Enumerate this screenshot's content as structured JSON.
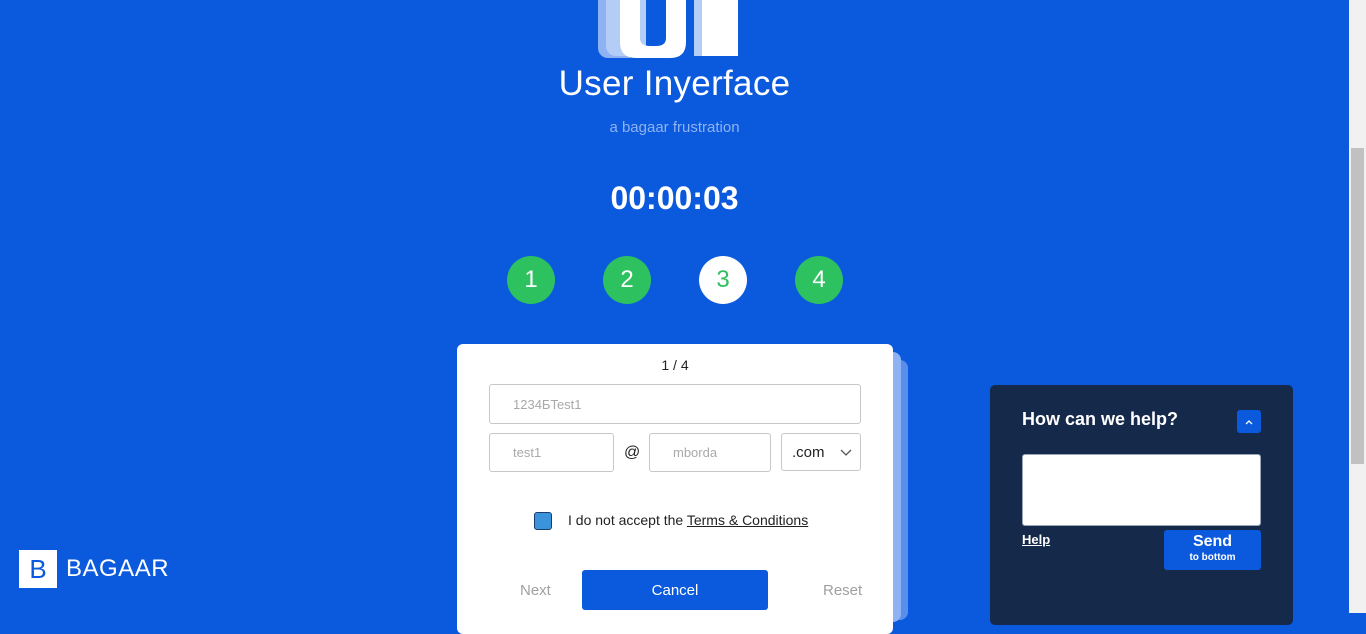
{
  "header": {
    "logo_text": "UI",
    "title": "User Inyerface",
    "subtitle": "a bagaar frustration"
  },
  "timer": "00:00:03",
  "steps": [
    {
      "label": "1",
      "state": "done"
    },
    {
      "label": "2",
      "state": "done"
    },
    {
      "label": "3",
      "state": "current"
    },
    {
      "label": "4",
      "state": "done"
    }
  ],
  "form": {
    "page_indicator": "1 / 4",
    "password_placeholder": "1234БTest1",
    "email_placeholder": "test1",
    "at_sign": "@",
    "domain_placeholder": "mborda",
    "tld_value": ".com",
    "terms_prefix": "I do not accept the ",
    "terms_link": "Terms & Conditions",
    "next_label": "Next",
    "cancel_label": "Cancel",
    "reset_label": "Reset"
  },
  "brand": {
    "icon_letter": "B",
    "name": "BAGAAR"
  },
  "help": {
    "title": "How can we help?",
    "help_link": "Help",
    "send_label": "Send",
    "send_sublabel": "to bottom"
  },
  "colors": {
    "background": "#0b59dd",
    "step_done": "#2dc15f",
    "help_panel": "#15294a",
    "checkbox": "#3b93db"
  }
}
